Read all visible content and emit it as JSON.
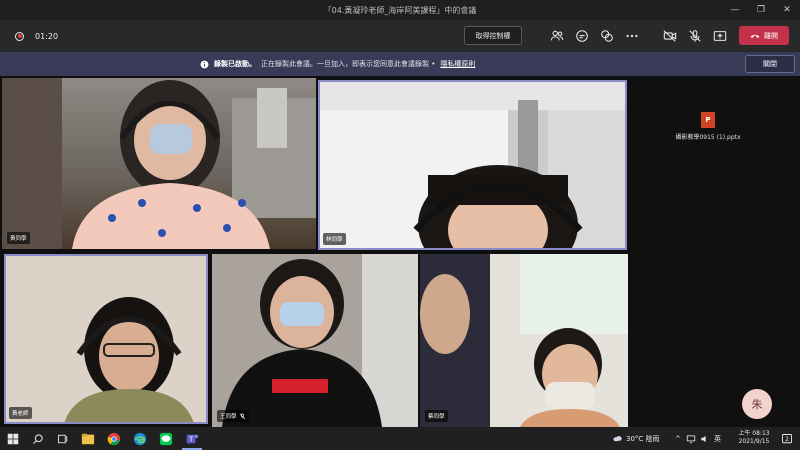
{
  "window": {
    "title": "「04.黃凝玲老師_海岸阿美課程」中的會議",
    "controls": [
      "—",
      "❐",
      "✕"
    ]
  },
  "toolbar": {
    "timer": "01:20",
    "control_button": "取得控制權",
    "leave_button": "離開"
  },
  "banner": {
    "title": "錄製已啟動。",
    "message": "正在錄製此會議。一旦加入，即表示您同意此會議錄製 •",
    "link": "隱私權原則",
    "close_button": "關閉"
  },
  "participants": [
    {
      "name": "黃同學",
      "muted": false
    },
    {
      "name": "林同學",
      "muted": false
    },
    {
      "name": "黃老師",
      "muted": false
    },
    {
      "name": "王同學",
      "muted": true
    },
    {
      "name": "蔡同學",
      "muted": false
    }
  ],
  "shared_file": {
    "name": "攝影教學0915 (1).pptx",
    "icon": "P"
  },
  "avatar": {
    "initial": "朱"
  },
  "taskbar": {
    "weather": "30°C 陰雨",
    "ime": "英",
    "time": "上午 08:13",
    "date": "2021/9/15",
    "notification_count": "2"
  },
  "colors": {
    "accent": "#8b8cc7",
    "leave": "#c4314b",
    "banner": "#393a58"
  }
}
